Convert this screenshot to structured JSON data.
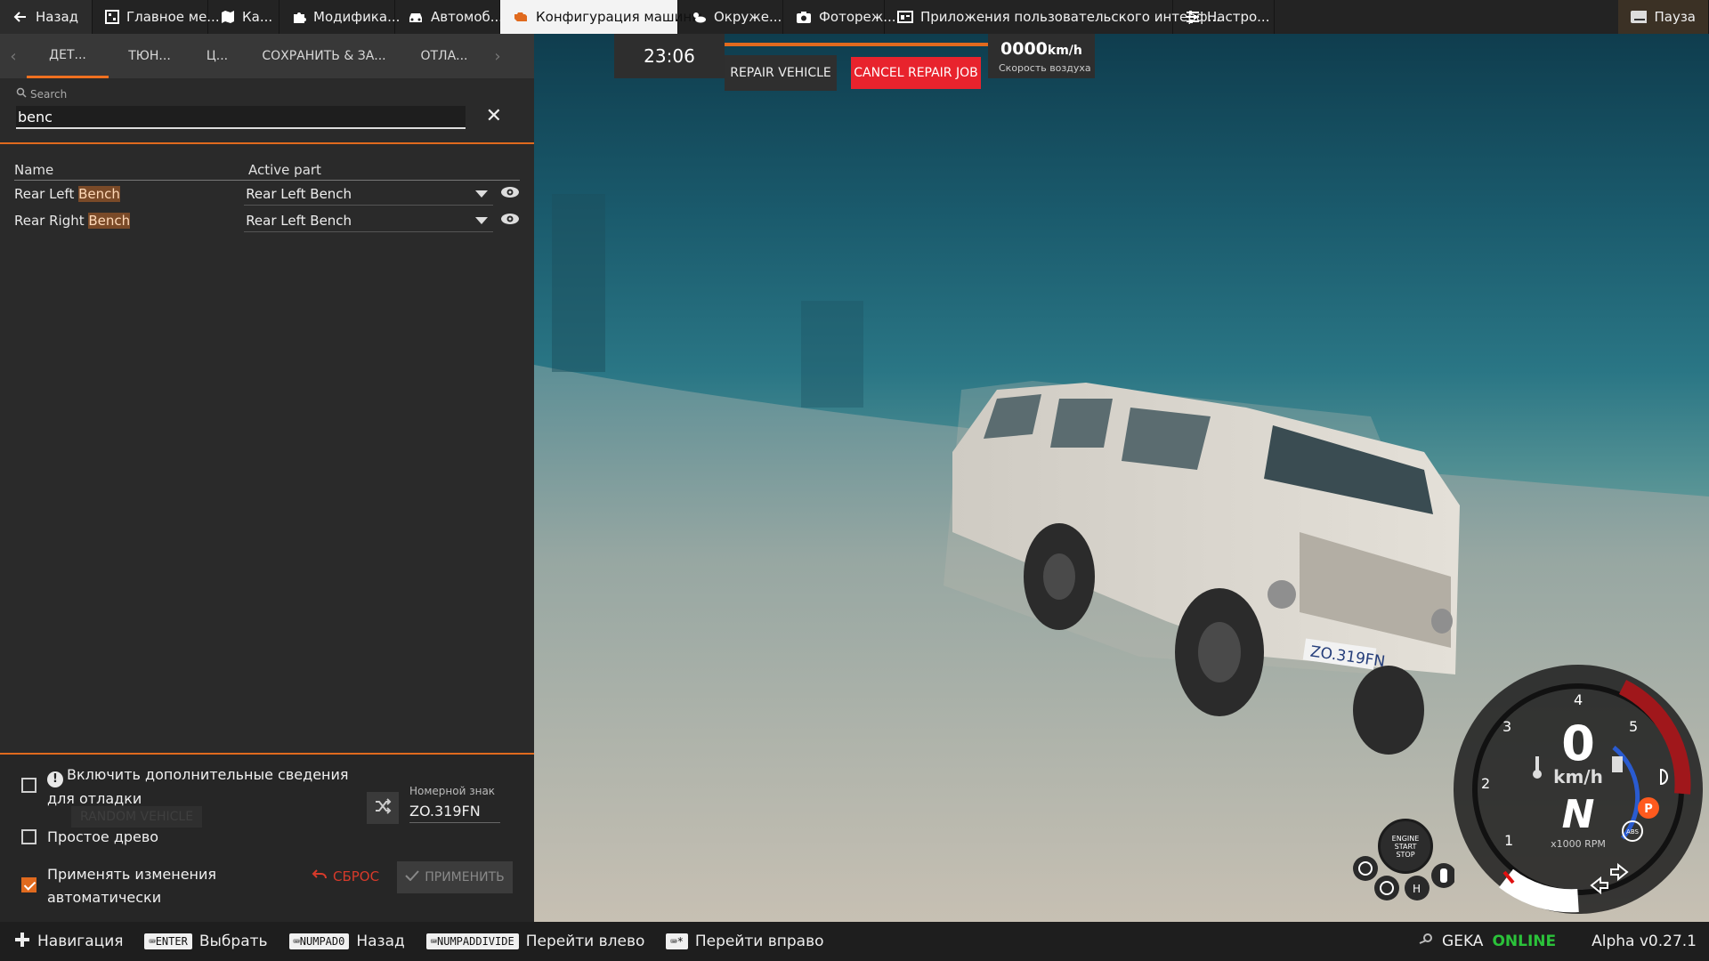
{
  "topbar": {
    "back_label": "Назад",
    "tabs": [
      {
        "label": "Главное ме...",
        "icon": "grid-icon"
      },
      {
        "label": "Ка...",
        "icon": "map-icon"
      },
      {
        "label": "Модифика...",
        "icon": "puzzle-icon"
      },
      {
        "label": "Автомоб...",
        "icon": "car-icon"
      },
      {
        "label": "Конфигурация машины",
        "icon": "engine-icon",
        "active": true
      },
      {
        "label": "Окруже...",
        "icon": "weather-icon"
      },
      {
        "label": "Фотореж...",
        "icon": "camera-icon"
      },
      {
        "label": "Приложения пользовательского интерф...",
        "icon": "ui-apps-icon"
      },
      {
        "label": "Настро...",
        "icon": "sliders-icon"
      }
    ],
    "pause_label": "Пауза"
  },
  "subtabs": [
    "ДЕТ...",
    "ТЮН...",
    "Ц...",
    "СОХРАНИТЬ & ЗА...",
    "ОТЛА..."
  ],
  "search": {
    "label": "Search",
    "value": "benc"
  },
  "parts_table": {
    "headers": {
      "name": "Name",
      "active_part": "Active part"
    },
    "rows": [
      {
        "name_prefix": "Rear Left ",
        "name_highlight": "Bench",
        "active_part": "Rear Left Bench"
      },
      {
        "name_prefix": "Rear Right ",
        "name_highlight": "Bench",
        "active_part": "Rear Left Bench"
      }
    ]
  },
  "options": {
    "debug_line1": "Включить дополнительные сведения",
    "debug_line2": "для отладки",
    "simple_tree": "Простое древо",
    "auto_apply_line1": "Применять изменения",
    "auto_apply_line2": "автоматически",
    "random_vehicle": "RANDOM VEHICLE",
    "plate_label": "Номерной знак",
    "plate_value": "ZO.319FN",
    "reset": "СБРОС",
    "apply": "ПРИМЕНИТЬ",
    "debug_checked": false,
    "simple_tree_checked": false,
    "auto_apply_checked": true
  },
  "repair_hud": {
    "time": "23:06",
    "repair_label": "REPAIR VEHICLE",
    "cancel_label": "CANCEL REPAIR JOB",
    "air_speed": "0000",
    "air_unit": "km/h",
    "air_label": "Скорость воздуха"
  },
  "dashboard": {
    "speed": "0",
    "speed_unit": "km/h",
    "gear": "N",
    "rpm_label": "x1000 RPM",
    "rpm_ticks": [
      "1",
      "2",
      "3",
      "4",
      "5"
    ],
    "engine_btn": [
      "ENGINE",
      "START",
      "STOP"
    ],
    "parking_label": "P",
    "abs_label": "ABS"
  },
  "bottombar": {
    "navigation": "Навигация",
    "hints": [
      {
        "key": "ENTER",
        "label": "Выбрать"
      },
      {
        "key": "NUMPAD0",
        "label": "Назад"
      },
      {
        "key": "NUMPADDIVIDE",
        "label": "Перейти влево"
      },
      {
        "key": "*",
        "label": "Перейти вправо"
      }
    ],
    "username": "GEKA",
    "status": "ONLINE",
    "version": "Alpha v0.27.1"
  },
  "colors": {
    "accent": "#e06a1e",
    "cancel": "#e8232d",
    "online": "#2bc23a"
  }
}
